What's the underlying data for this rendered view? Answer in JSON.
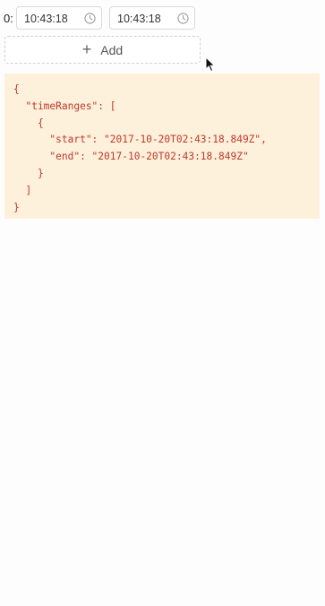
{
  "time_range_row": {
    "prefix": "0:",
    "start_value": "10:43:18",
    "end_value": "10:43:18",
    "clock_icon": "clock-icon"
  },
  "add_button": {
    "icon": "plus-icon",
    "label": "Add"
  },
  "json_preview": {
    "lines": [
      "{",
      "  \"timeRanges\": [",
      "    {",
      "      \"start\": \"2017-10-20T02:43:18.849Z\",",
      "      \"end\": \"2017-10-20T02:43:18.849Z\"",
      "    }",
      "  ]",
      "}"
    ]
  },
  "colors": {
    "json_text": "#c0392b",
    "json_background": "#fdf1dc",
    "border": "#d9d9d9"
  }
}
